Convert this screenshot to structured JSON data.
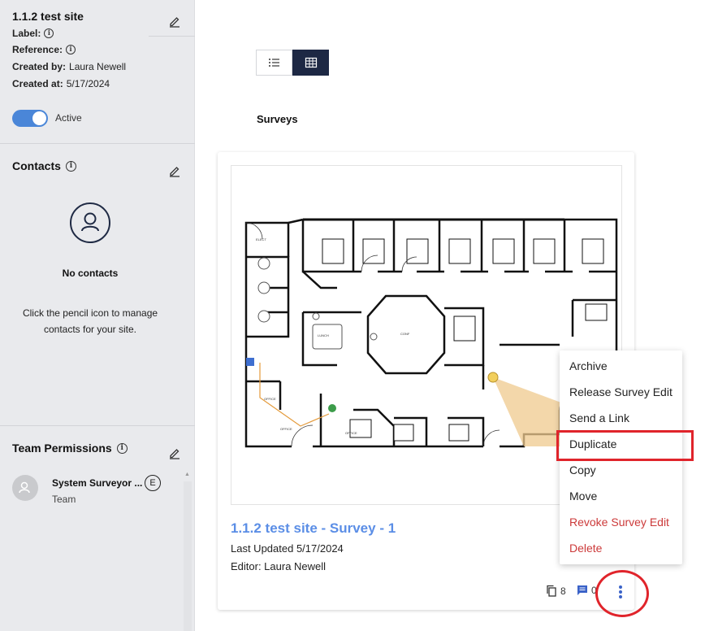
{
  "site": {
    "title": "1.1.2 test site",
    "label_key": "Label:",
    "reference_key": "Reference:",
    "created_by_key": "Created by:",
    "created_by": "Laura Newell",
    "created_at_key": "Created at:",
    "created_at": "5/17/2024",
    "active_label": "Active",
    "active": true
  },
  "contacts": {
    "heading": "Contacts",
    "empty_title": "No contacts",
    "help_text": "Click the pencil icon to manage contacts for your site."
  },
  "team": {
    "heading": "Team Permissions",
    "members": [
      {
        "name": "System Surveyor ...",
        "badge": "E",
        "role": "Team"
      }
    ]
  },
  "main": {
    "surveys_heading": "Surveys",
    "view_mode": "grid"
  },
  "survey_card": {
    "title": "1.1.2 test site - Survey - 1",
    "last_updated": "Last Updated 5/17/2024",
    "editor": "Editor: Laura Newell",
    "copies_count": "8",
    "comments_count": "0"
  },
  "context_menu": {
    "items": [
      {
        "label": "Archive",
        "danger": false
      },
      {
        "label": "Release Survey Edit",
        "danger": false
      },
      {
        "label": "Send a Link",
        "danger": false
      },
      {
        "label": "Duplicate",
        "danger": false
      },
      {
        "label": "Copy",
        "danger": false
      },
      {
        "label": "Move",
        "danger": false
      },
      {
        "label": "Revoke Survey Edit",
        "danger": true
      },
      {
        "label": "Delete",
        "danger": true
      }
    ]
  },
  "colors": {
    "accent": "#4a86d8",
    "nav_dark": "#1d2844",
    "danger": "#cc3a3a",
    "highlight": "#e0242b"
  },
  "icons": [
    "pencil-icon",
    "info-icon",
    "person-icon",
    "list-icon",
    "grid-icon",
    "copy-icon",
    "comment-icon",
    "more-vertical-icon"
  ]
}
